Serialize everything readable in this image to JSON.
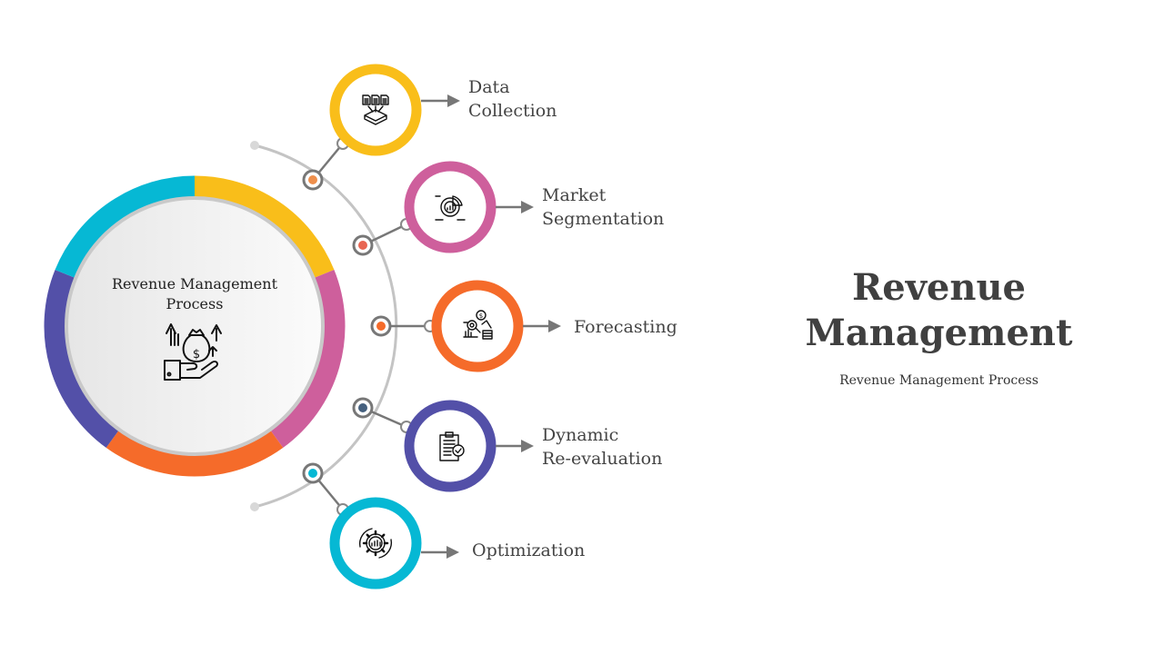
{
  "center": {
    "title": "Revenue Management Process",
    "icon": "hand-money-bag-growth-icon"
  },
  "ring_colors": [
    "#F9BE1A",
    "#CE5F9C",
    "#F56B2A",
    "#5350A8",
    "#06B8D4"
  ],
  "steps": [
    {
      "label": "Data\nCollection",
      "color": "#F9BE1A",
      "node_color": "#EE8F4C",
      "icon": "data-collection-icon"
    },
    {
      "label": "Market\nSegmentation",
      "color": "#CE5F9C",
      "node_color": "#E86552",
      "icon": "market-segmentation-icon"
    },
    {
      "label": "Forecasting",
      "color": "#F56B2A",
      "node_color": "#F56B2A",
      "icon": "forecasting-icon"
    },
    {
      "label": "Dynamic\nRe-evaluation",
      "color": "#5350A8",
      "node_color": "#45607E",
      "icon": "clipboard-check-icon"
    },
    {
      "label": "Optimization",
      "color": "#06B8D4",
      "node_color": "#06B8D4",
      "icon": "gear-chart-icon"
    }
  ],
  "heading": {
    "title_line1": "Revenue",
    "title_line2": "Management",
    "subtitle": "Revenue Management Process"
  }
}
